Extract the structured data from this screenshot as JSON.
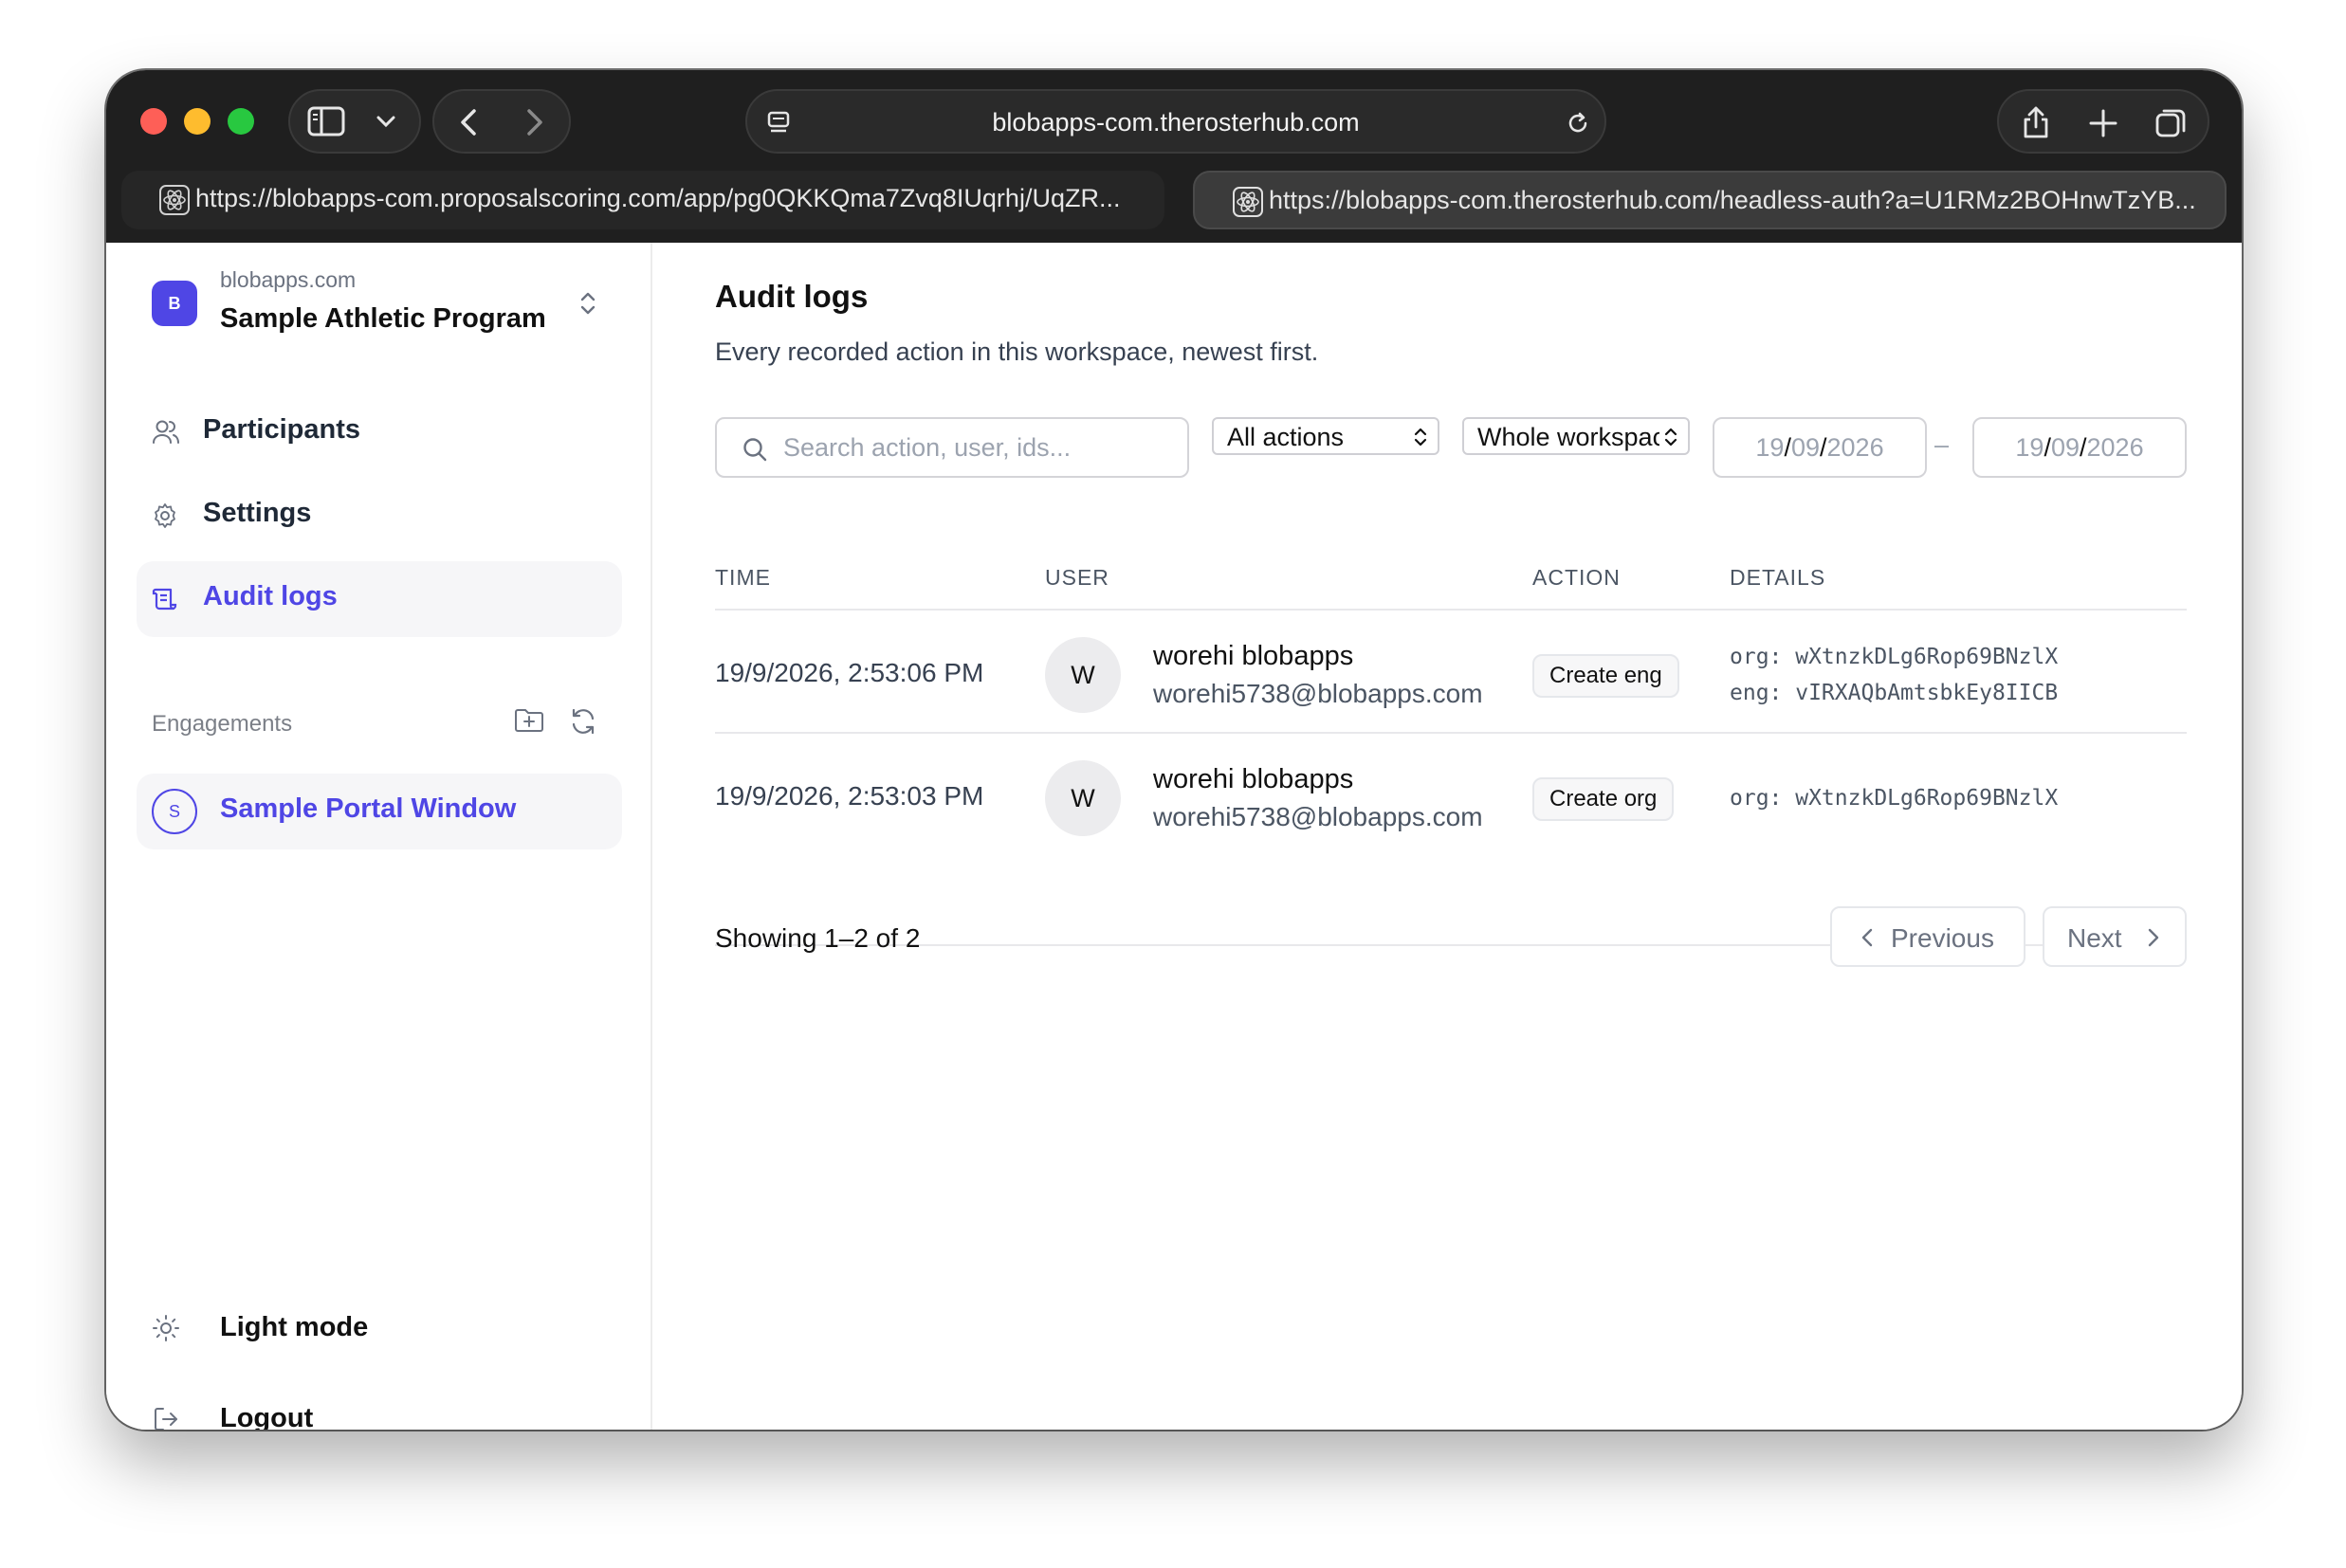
{
  "browser": {
    "address": "blobapps-com.therosterhub.com",
    "tabs": [
      {
        "url": "https://blobapps-com.proposalscoring.com/app/pg0QKKQma7Zvq8IUqrhj/UqZR..."
      },
      {
        "url": "https://blobapps-com.therosterhub.com/headless-auth?a=U1RMz2BOHnwTzYB..."
      }
    ]
  },
  "sidebar": {
    "workspace": {
      "avatar_letter": "B",
      "domain": "blobapps.com",
      "name": "Sample Athletic Program"
    },
    "nav": [
      {
        "label": "Participants",
        "icon": "users-icon"
      },
      {
        "label": "Settings",
        "icon": "gear-icon"
      },
      {
        "label": "Audit logs",
        "icon": "scroll-icon",
        "active": true
      }
    ],
    "engagements_label": "Engagements",
    "engagements": [
      {
        "avatar_letter": "S",
        "label": "Sample Portal Window"
      }
    ],
    "theme_label": "Light mode",
    "logout_label": "Logout"
  },
  "main": {
    "title": "Audit logs",
    "subtitle": "Every recorded action in this workspace, newest first.",
    "filters": {
      "search_placeholder": "Search action, user, ids...",
      "action_select": "All actions",
      "scope_select": "Whole workspace",
      "date_from": {
        "day": "19",
        "month": "09",
        "year": "2026"
      },
      "date_to": {
        "day": "19",
        "month": "09",
        "year": "2026"
      },
      "range_separator": "–"
    },
    "table": {
      "headers": [
        "TIME",
        "USER",
        "ACTION",
        "DETAILS"
      ],
      "rows": [
        {
          "time": "19/9/2026, 2:53:06 PM",
          "avatar": "W",
          "name": "worehi blobapps",
          "email": "worehi5738@blobapps.com",
          "action": "Create eng",
          "details": [
            "org: wXtnzkDLg6Rop69BNzlX",
            "eng: vIRXAQbAmtsbkEy8IICB"
          ]
        },
        {
          "time": "19/9/2026, 2:53:03 PM",
          "avatar": "W",
          "name": "worehi blobapps",
          "email": "worehi5738@blobapps.com",
          "action": "Create org",
          "details": [
            "org: wXtnzkDLg6Rop69BNzlX"
          ]
        }
      ]
    },
    "pagination": {
      "summary": "Showing 1–2 of 2",
      "previous": "Previous",
      "next": "Next"
    }
  },
  "colors": {
    "accent": "#4f46e5",
    "titlebar": "#1f1f1f",
    "text": "#111111",
    "muted": "#6b7280"
  }
}
